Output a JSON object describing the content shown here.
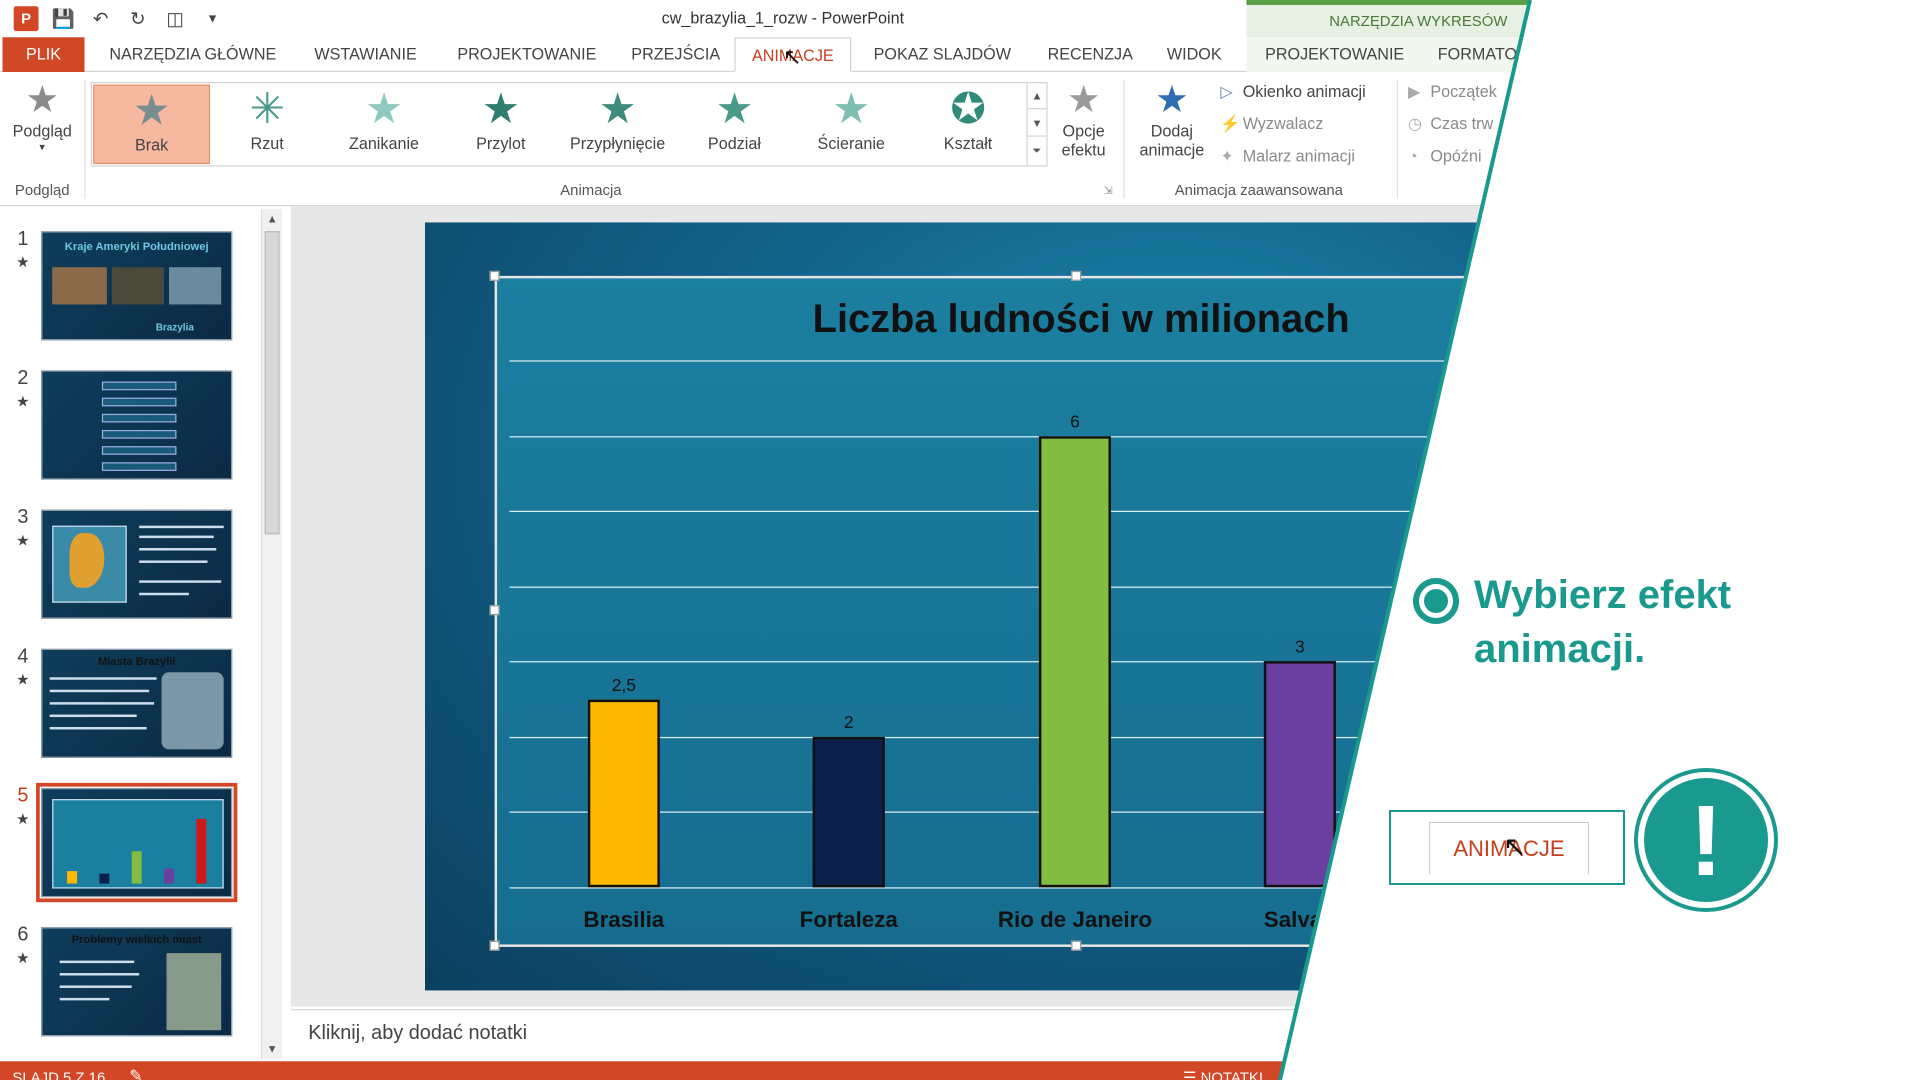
{
  "window": {
    "title": "cw_brazylia_1_rozw - PowerPoint",
    "context_header": "NARZĘDZIA WYKRESÓW"
  },
  "tabs": {
    "plik": "PLIK",
    "items": [
      "NARZĘDZIA GŁÓWNE",
      "WSTAWIANIE",
      "PROJEKTOWANIE",
      "PRZEJŚCIA",
      "ANIMACJE",
      "POKAZ SLAJDÓW",
      "RECENZJA",
      "WIDOK"
    ],
    "active": "ANIMACJE",
    "context": [
      "PROJEKTOWANIE",
      "FORMATO"
    ]
  },
  "ribbon": {
    "preview": {
      "label": "Podgląd",
      "group": "Podgląd"
    },
    "animations": [
      "Brak",
      "Rzut",
      "Zanikanie",
      "Przylot",
      "Przypłynięcie",
      "Podział",
      "Ścieranie",
      "Kształt"
    ],
    "selected_animation": "Brak",
    "effect_options": [
      "Opcje",
      "efektu"
    ],
    "group_animation": "Animacja",
    "add_animation": [
      "Dodaj",
      "animacje"
    ],
    "advanced": [
      "Okienko animacji",
      "Wyzwalacz",
      "Malarz animacji"
    ],
    "group_advanced": "Animacja zaawansowana",
    "timing": [
      "Początek",
      "Czas trw",
      "Opóźni"
    ]
  },
  "thumbnails": [
    {
      "num": "1",
      "title": "Kraje Ameryki Południowej",
      "subtitle": "Brazylia"
    },
    {
      "num": "2",
      "title": ""
    },
    {
      "num": "3",
      "title": ""
    },
    {
      "num": "4",
      "title": "Miasta Brazylii"
    },
    {
      "num": "5",
      "title": "",
      "active": true
    },
    {
      "num": "6",
      "title": "Problemy wielkich miast"
    }
  ],
  "chart_data": {
    "type": "bar",
    "title": "Liczba ludności w milionach",
    "categories": [
      "Brasilia",
      "Fortaleza",
      "Rio de Janeiro",
      "Salvad"
    ],
    "values": [
      2.5,
      2,
      6,
      3
    ],
    "value_labels": [
      "2,5",
      "2",
      "6",
      "3"
    ],
    "colors": [
      "#ffb800",
      "#0d1f4c",
      "#82bc40",
      "#6b3fa0"
    ],
    "ylim": [
      0,
      7
    ],
    "grid": true
  },
  "notes_placeholder": "Kliknij, aby dodać notatki",
  "status": {
    "slide": "SLAJD 5 Z 16",
    "notes": "NOTATKI"
  },
  "hint": {
    "text": "Wybierz efekt animacji.",
    "tab_label": "ANIMACJE",
    "accent": "#1a9a8e"
  }
}
